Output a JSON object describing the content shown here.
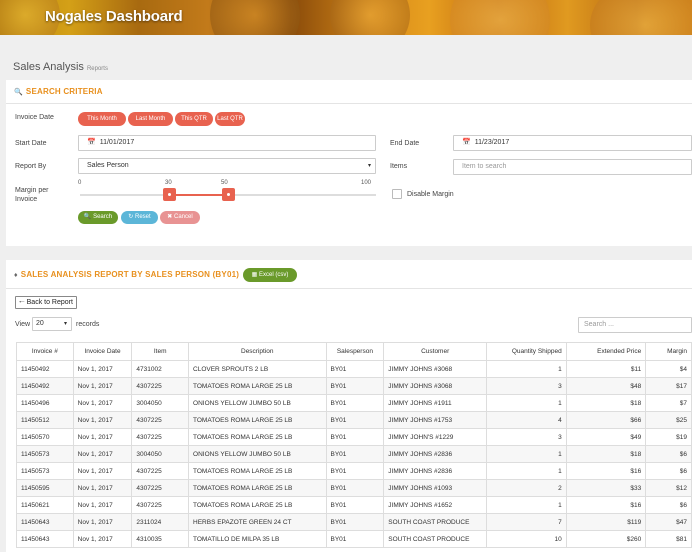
{
  "app": {
    "title": "Nogales Dashboard"
  },
  "page": {
    "title": "Sales Analysis",
    "subtitle": "Reports"
  },
  "criteria": {
    "title": "Search Criteria",
    "invoice_date_label": "Invoice Date",
    "presets": [
      "This Month",
      "Last Month",
      "This QTR",
      "Last QTR"
    ],
    "start_date_label": "Start Date",
    "start_date_value": "11/01/2017",
    "end_date_label": "End Date",
    "end_date_value": "11/23/2017",
    "report_by_label": "Report By",
    "report_by_value": "Sales Person",
    "items_label": "Items",
    "items_placeholder": "Item to search",
    "margin_label": "Margin per Invoice",
    "slider": {
      "min_label": "0",
      "max_label": "100",
      "low": 30,
      "high": 50
    },
    "disable_margin_label": "Disable Margin",
    "search_label": "Search",
    "reset_label": "Reset",
    "cancel_label": "Cancel"
  },
  "report": {
    "title": "Sales Analysis Report by Sales Person (BY01)",
    "excel_label": "Excel (csv)",
    "back_label": "Back to Report",
    "view_label": "View",
    "view_value": "20",
    "records_label": "records",
    "search_placeholder": "Search ...",
    "columns": [
      "Invoice #",
      "Invoice Date",
      "Item",
      "Description",
      "Salesperson",
      "Customer",
      "Quantity Shipped",
      "Extended Price",
      "Margin"
    ],
    "rows": [
      [
        "11450492",
        "Nov 1, 2017",
        "4731002",
        "CLOVER SPROUTS 2 LB",
        "BY01",
        "JIMMY JOHNS #3068",
        "1",
        "$11",
        "$4"
      ],
      [
        "11450492",
        "Nov 1, 2017",
        "4307225",
        "TOMATOES ROMA LARGE 25 LB",
        "BY01",
        "JIMMY JOHNS #3068",
        "3",
        "$48",
        "$17"
      ],
      [
        "11450496",
        "Nov 1, 2017",
        "3004050",
        "ONIONS YELLOW JUMBO 50 LB",
        "BY01",
        "JIMMY JOHNS #1911",
        "1",
        "$18",
        "$7"
      ],
      [
        "11450512",
        "Nov 1, 2017",
        "4307225",
        "TOMATOES ROMA LARGE 25 LB",
        "BY01",
        "JIMMY JOHNS #1753",
        "4",
        "$66",
        "$25"
      ],
      [
        "11450570",
        "Nov 1, 2017",
        "4307225",
        "TOMATOES ROMA LARGE 25 LB",
        "BY01",
        "JIMMY JOHN'S #1229",
        "3",
        "$49",
        "$19"
      ],
      [
        "11450573",
        "Nov 1, 2017",
        "3004050",
        "ONIONS YELLOW JUMBO 50 LB",
        "BY01",
        "JIMMY JOHNS #2836",
        "1",
        "$18",
        "$6"
      ],
      [
        "11450573",
        "Nov 1, 2017",
        "4307225",
        "TOMATOES ROMA LARGE 25 LB",
        "BY01",
        "JIMMY JOHNS #2836",
        "1",
        "$16",
        "$6"
      ],
      [
        "11450595",
        "Nov 1, 2017",
        "4307225",
        "TOMATOES ROMA LARGE 25 LB",
        "BY01",
        "JIMMY JOHNS #1093",
        "2",
        "$33",
        "$12"
      ],
      [
        "11450621",
        "Nov 1, 2017",
        "4307225",
        "TOMATOES ROMA LARGE 25 LB",
        "BY01",
        "JIMMY JOHNS #1652",
        "1",
        "$16",
        "$6"
      ],
      [
        "11450643",
        "Nov 1, 2017",
        "2311024",
        "HERBS EPAZOTE GREEN 24 CT",
        "BY01",
        "SOUTH COAST PRODUCE",
        "7",
        "$119",
        "$47"
      ],
      [
        "11450643",
        "Nov 1, 2017",
        "4310035",
        "TOMATILLO DE MILPA 35 LB",
        "BY01",
        "SOUTH COAST PRODUCE",
        "10",
        "$260",
        "$81"
      ]
    ]
  },
  "colors": {
    "accent": "#e8901e",
    "pill": "#e8624f",
    "green": "#6a9a2a",
    "blue": "#5cb6d8",
    "pink": "#e89393"
  }
}
